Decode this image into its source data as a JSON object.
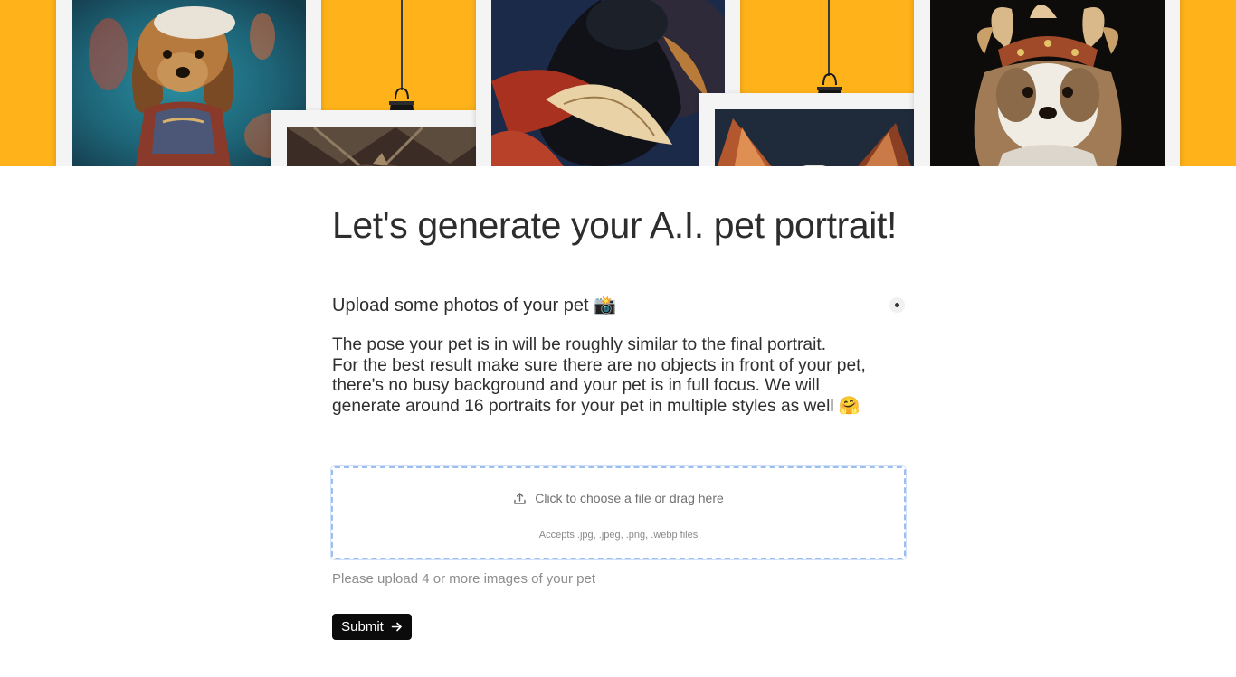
{
  "page": {
    "title": "Let's generate your A.I. pet portrait!",
    "upload_heading": "Upload some photos of your pet",
    "upload_heading_emoji": "📸",
    "description_lines": [
      "The pose your pet is in will be roughly similar to the final portrait.",
      "For the best result make sure there are no objects in front of your pet,",
      "there's no busy background and your pet is in full focus. We will",
      "generate around 16 portraits for your pet in multiple styles as well 🤗"
    ],
    "menu_icon": "dot-icon"
  },
  "dropzone": {
    "label": "Click to choose a file or drag here",
    "accepts": "Accepts .jpg, .jpeg, .png, .webp files",
    "icon": "upload-icon"
  },
  "hint": "Please upload 4 or more images of your pet",
  "submit": {
    "label": "Submit",
    "icon": "arrow-right-icon"
  },
  "colors": {
    "banner_background": "#ffb21a",
    "button_background": "#0b0b0b",
    "dropzone_border": "#9cbff0"
  },
  "hero_images": [
    "shih-tzu-portrait-teal",
    "cat-portrait-bottom-left",
    "black-dog-portrait-feathers",
    "cat-portrait-bottom-right",
    "shih-tzu-portrait-headdress"
  ]
}
